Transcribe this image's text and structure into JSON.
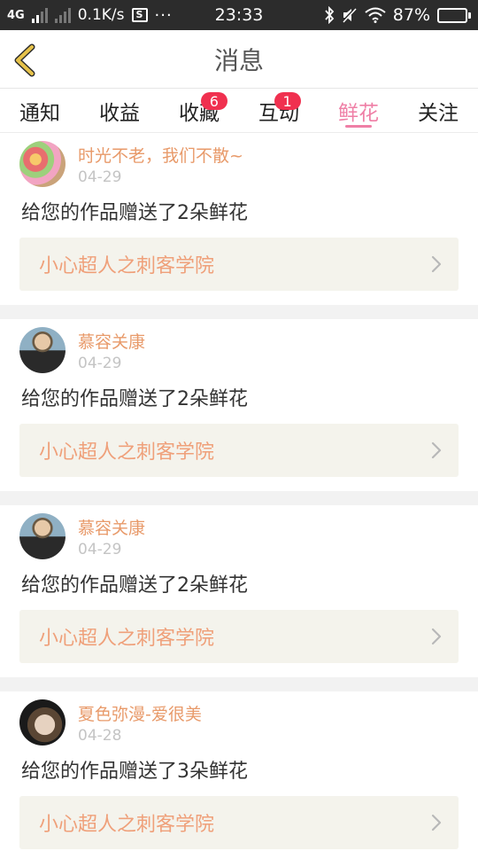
{
  "status_bar": {
    "network": "4G",
    "speed": "0.1K/s",
    "icon_label": "S",
    "dots": "···",
    "time": "23:33",
    "battery": "87%",
    "battery_level": 0.87
  },
  "header": {
    "title": "消息"
  },
  "tabs": [
    {
      "label": "通知",
      "badge": ""
    },
    {
      "label": "收益",
      "badge": ""
    },
    {
      "label": "收藏",
      "badge": "6"
    },
    {
      "label": "互动",
      "badge": "1"
    },
    {
      "label": "鲜花",
      "badge": "",
      "active": true
    },
    {
      "label": "关注",
      "badge": ""
    }
  ],
  "messages": [
    {
      "user": "时光不老，我们不散~",
      "date": "04-29",
      "text": "给您的作品赠送了2朵鲜花",
      "work": "小心超人之刺客学院"
    },
    {
      "user": "慕容关康",
      "date": "04-29",
      "text": "给您的作品赠送了2朵鲜花",
      "work": "小心超人之刺客学院"
    },
    {
      "user": "慕容关康",
      "date": "04-29",
      "text": "给您的作品赠送了2朵鲜花",
      "work": "小心超人之刺客学院"
    },
    {
      "user": "夏色弥漫-爱很美",
      "date": "04-28",
      "text": "给您的作品赠送了3朵鲜花",
      "work": "小心超人之刺客学院"
    }
  ],
  "colors": {
    "accent": "#ef7fa6",
    "badge": "#f0304f",
    "username": "#e89a6a",
    "work_title": "#efa07a",
    "back_arrow": "#e6c24a"
  },
  "icons": {
    "back": "back-arrow-icon",
    "chevron": "chevron-right-icon",
    "bluetooth": "bluetooth-icon",
    "mute": "mute-icon",
    "wifi": "wifi-icon",
    "battery": "battery-icon"
  }
}
